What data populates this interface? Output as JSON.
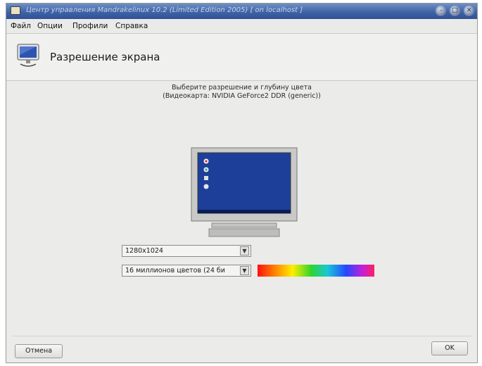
{
  "window": {
    "title": "Центр управления Mandrakelinux 10.2 (Limited Edition 2005) [ on localhost ]"
  },
  "menu": [
    "Файл",
    "Опции",
    "Профили",
    "Справка"
  ],
  "header": {
    "title": "Разрешение экрана"
  },
  "prompt": {
    "line1": "Выберите разрешение и глубину цвета",
    "line2": "(Видеокарта: NVIDIA GeForce2 DDR (generic))"
  },
  "resolution": {
    "value": "1280x1024"
  },
  "color_depth": {
    "value": "16 миллионов цветов (24 би"
  },
  "buttons": {
    "cancel": "Отмена",
    "ok": "OK"
  }
}
